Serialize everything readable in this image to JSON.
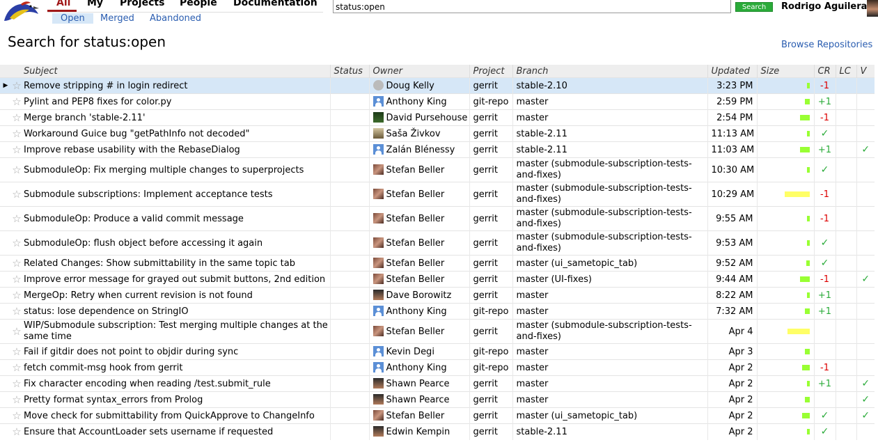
{
  "nav": {
    "tabs": [
      "All",
      "My",
      "Projects",
      "People",
      "Documentation"
    ],
    "subtabs": [
      "Open",
      "Merged",
      "Abandoned"
    ]
  },
  "search": {
    "value": "status:open",
    "button": "Search"
  },
  "user": {
    "name": "Rodrigo Aguilera"
  },
  "page": {
    "title": "Search for status:open",
    "browse_link": "Browse Repositories"
  },
  "columns": [
    "Subject",
    "Status",
    "Owner",
    "Project",
    "Branch",
    "Updated",
    "Size",
    "CR",
    "LC",
    "V"
  ],
  "colors": {
    "accent": "#A1191A",
    "link": "#2a5db0",
    "positive": "#2aab39",
    "negative": "#dd0000",
    "size_small": "#99ff33",
    "size_large": "#ffff66"
  },
  "rows": [
    {
      "subject": "Remove stripping # in login redirect",
      "owner": "Doug Kelly",
      "avatar": "doug",
      "project": "gerrit",
      "branch": "stable-2.10",
      "updated": "3:23 PM",
      "size": 0.1,
      "cr": "-1",
      "lc": "",
      "v": "",
      "highlight": true
    },
    {
      "subject": "Pylint and PEP8 fixes for color.py",
      "owner": "Anthony King",
      "avatar": "user",
      "project": "git-repo",
      "branch": "master",
      "updated": "2:59 PM",
      "size": 0.2,
      "cr": "+1",
      "lc": "",
      "v": ""
    },
    {
      "subject": "Merge branch 'stable-2.11'",
      "owner": "David Pursehouse",
      "avatar": "green",
      "project": "gerrit",
      "branch": "master",
      "updated": "2:54 PM",
      "size": 0.4,
      "cr": "-1",
      "lc": "",
      "v": ""
    },
    {
      "subject": "Workaround Guice bug \"getPathInfo not decoded\"",
      "owner": "Saša Živkov",
      "avatar": "land",
      "project": "gerrit",
      "branch": "stable-2.11",
      "updated": "11:13 AM",
      "size": 0.1,
      "cr": "✓",
      "lc": "",
      "v": ""
    },
    {
      "subject": "Improve rebase usability with the RebaseDialog",
      "owner": "Zalán Blénessy",
      "avatar": "user",
      "project": "gerrit",
      "branch": "stable-2.11",
      "updated": "11:03 AM",
      "size": 0.4,
      "cr": "+1",
      "lc": "",
      "v": "✓"
    },
    {
      "subject": "SubmoduleOp: Fix merging multiple changes to superprojects",
      "owner": "Stefan Beller",
      "avatar": "photo",
      "project": "gerrit",
      "branch": "master (submodule-subscription-tests-and-fixes)",
      "updated": "10:30 AM",
      "size": 0.1,
      "cr": "✓",
      "lc": "",
      "v": ""
    },
    {
      "subject": "Submodule subscriptions: Implement acceptance tests",
      "owner": "Stefan Beller",
      "avatar": "photo",
      "project": "gerrit",
      "branch": "master (submodule-subscription-tests-and-fixes)",
      "updated": "10:29 AM",
      "size": 1.0,
      "cr": "-1",
      "lc": "",
      "v": ""
    },
    {
      "subject": "SubmoduleOp: Produce a valid commit message",
      "owner": "Stefan Beller",
      "avatar": "photo",
      "project": "gerrit",
      "branch": "master (submodule-subscription-tests-and-fixes)",
      "updated": "9:55 AM",
      "size": 0.1,
      "cr": "-1",
      "lc": "",
      "v": ""
    },
    {
      "subject": "SubmoduleOp: flush object before accessing it again",
      "owner": "Stefan Beller",
      "avatar": "photo",
      "project": "gerrit",
      "branch": "master (submodule-subscription-tests-and-fixes)",
      "updated": "9:53 AM",
      "size": 0.1,
      "cr": "✓",
      "lc": "",
      "v": ""
    },
    {
      "subject": "Related Changes: Show submittability in the same topic tab",
      "owner": "Stefan Beller",
      "avatar": "photo",
      "project": "gerrit",
      "branch": "master (ui_sametopic_tab)",
      "updated": "9:52 AM",
      "size": 0.15,
      "cr": "✓",
      "lc": "",
      "v": ""
    },
    {
      "subject": "Improve error message for grayed out submit buttons, 2nd edition",
      "owner": "Stefan Beller",
      "avatar": "photo",
      "project": "gerrit",
      "branch": "master (UI-fixes)",
      "updated": "9:44 AM",
      "size": 0.4,
      "cr": "-1",
      "lc": "",
      "v": "✓"
    },
    {
      "subject": "MergeOp: Retry when current revision is not found",
      "owner": "Dave Borowitz",
      "avatar": "dark",
      "project": "gerrit",
      "branch": "master",
      "updated": "8:22 AM",
      "size": 0.1,
      "cr": "+1",
      "lc": "",
      "v": ""
    },
    {
      "subject": "status: lose dependence on StringIO",
      "owner": "Anthony King",
      "avatar": "user",
      "project": "git-repo",
      "branch": "master",
      "updated": "7:32 AM",
      "size": 0.2,
      "cr": "+1",
      "lc": "",
      "v": ""
    },
    {
      "subject": "WIP/Submodule subscription: Test merging multiple changes at the same time",
      "owner": "Stefan Beller",
      "avatar": "photo",
      "project": "gerrit",
      "branch": "master (submodule-subscription-tests-and-fixes)",
      "updated": "Apr 4",
      "size": 0.9,
      "cr": "",
      "lc": "",
      "v": ""
    },
    {
      "subject": "Fail if gitdir does not point to objdir during sync",
      "owner": "Kevin Degi",
      "avatar": "user",
      "project": "git-repo",
      "branch": "master",
      "updated": "Apr 3",
      "size": 0.2,
      "cr": "",
      "lc": "",
      "v": ""
    },
    {
      "subject": "fetch commit-msg hook from gerrit",
      "owner": "Anthony King",
      "avatar": "user",
      "project": "git-repo",
      "branch": "master",
      "updated": "Apr 2",
      "size": 0.3,
      "cr": "-1",
      "lc": "",
      "v": ""
    },
    {
      "subject": "Fix character encoding when reading /test.submit_rule",
      "owner": "Shawn Pearce",
      "avatar": "dark",
      "project": "gerrit",
      "branch": "master",
      "updated": "Apr 2",
      "size": 0.1,
      "cr": "+1",
      "lc": "",
      "v": "✓"
    },
    {
      "subject": "Pretty format syntax_errors from Prolog",
      "owner": "Shawn Pearce",
      "avatar": "dark",
      "project": "gerrit",
      "branch": "master",
      "updated": "Apr 2",
      "size": 0.2,
      "cr": "",
      "lc": "",
      "v": "✓"
    },
    {
      "subject": "Move check for submittability from QuickApprove to ChangeInfo",
      "owner": "Stefan Beller",
      "avatar": "photo",
      "project": "gerrit",
      "branch": "master (ui_sametopic_tab)",
      "updated": "Apr 2",
      "size": 0.3,
      "cr": "✓",
      "lc": "",
      "v": "✓"
    },
    {
      "subject": "Ensure that AccountLoader sets username if requested",
      "owner": "Edwin Kempin",
      "avatar": "dark",
      "project": "gerrit",
      "branch": "stable-2.11",
      "updated": "Apr 2",
      "size": 0.1,
      "cr": "✓",
      "lc": "",
      "v": ""
    }
  ]
}
